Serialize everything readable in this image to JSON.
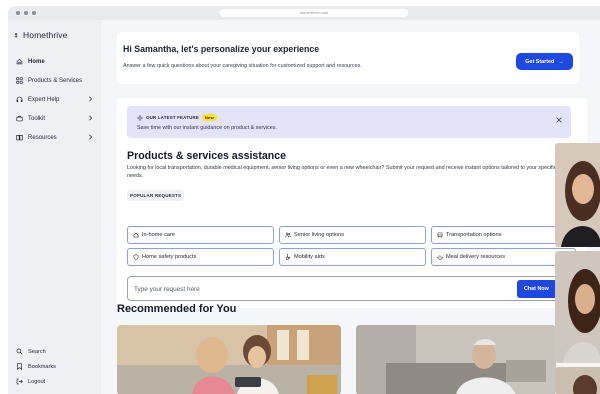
{
  "browser": {
    "url": "homethrive.com"
  },
  "sidebar": {
    "logo": "Homethrive",
    "items": [
      {
        "label": "Home",
        "icon": "home-icon"
      },
      {
        "label": "Products & Services",
        "icon": "grid-icon"
      },
      {
        "label": "Expert Help",
        "icon": "headset-icon"
      },
      {
        "label": "Toolkit",
        "icon": "toolkit-icon"
      },
      {
        "label": "Resources",
        "icon": "book-icon"
      }
    ],
    "bottom": [
      {
        "label": "Search",
        "icon": "search-icon"
      },
      {
        "label": "Bookmarks",
        "icon": "bookmark-icon"
      },
      {
        "label": "Logout",
        "icon": "logout-icon"
      }
    ]
  },
  "greeting": {
    "title": "Hi Samantha, let's personalize your experience",
    "subtitle": "Answer a few quick questions about your caregiving situation for customized support and resources.",
    "button": "Get Started",
    "button_arrow": "→"
  },
  "assistance": {
    "feature_label": "OUR LATEST FEATURE",
    "badge": "New",
    "feature_desc": "Save time with our instant guidance on product & services.",
    "title": "Products & services assistance",
    "lead": "Looking for local transportation, durable medical equipment, senior living options or even a new wheelchair? Submit your request and receive instant options tailored to your specific needs.",
    "popular_label": "POPULAR REQUESTS",
    "chips": [
      "In-home care",
      "Senior living options",
      "Transportation options",
      "Home safety products",
      "Mobility aids",
      "Meal delivery resources"
    ],
    "input_placeholder": "Type your request here",
    "chat_button": "Chat Now"
  },
  "recommended": {
    "title": "Recommended for You"
  },
  "colors": {
    "accent": "#1f48e0",
    "sidebar_bg": "#eef0f4",
    "banner_bg": "#e3e4f9",
    "badge_bg": "#f7e23c",
    "chip_border": "#8aa0e8"
  }
}
